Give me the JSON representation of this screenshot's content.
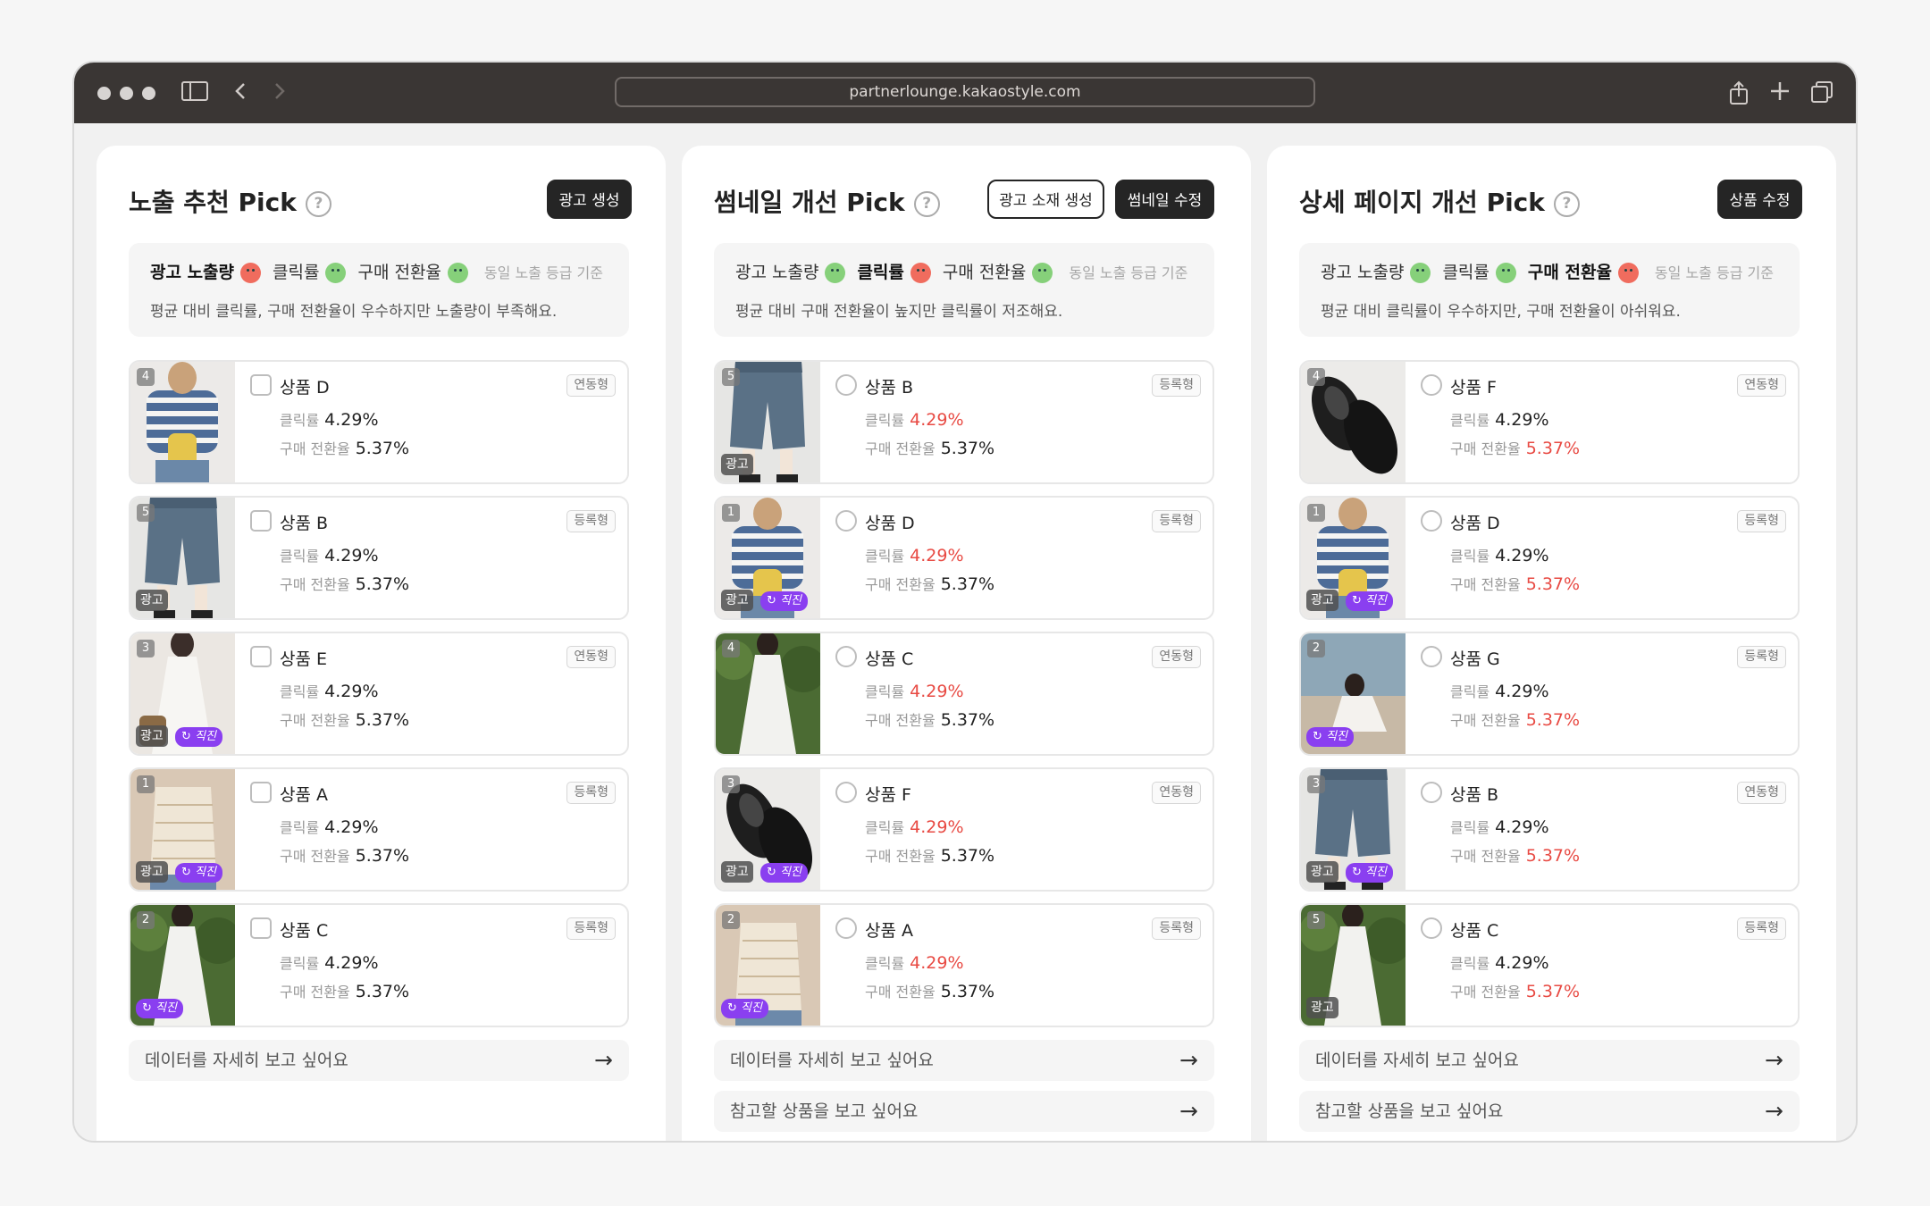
{
  "browser": {
    "url": "partnerlounge.kakaostyle.com",
    "icons": [
      "sidebar-icon",
      "back-icon",
      "forward-icon",
      "share-icon",
      "new-tab-icon",
      "tabs-icon"
    ]
  },
  "colors": {
    "accent": "#8a3ff0",
    "good": "#86d07a",
    "bad": "#f06c5e",
    "danger": "#e84a43"
  },
  "panels": [
    {
      "title": "노출 추천 Pick",
      "buttons": [
        {
          "label": "광고 생성",
          "style": "filled"
        }
      ],
      "summary": {
        "metrics": [
          {
            "label": "광고 노출량",
            "state": "bad",
            "bold": true
          },
          {
            "label": "클릭률",
            "state": "good",
            "bold": false
          },
          {
            "label": "구매 전환율",
            "state": "good",
            "bold": false
          }
        ],
        "basis": "동일 노출 등급 기준",
        "description": "평균 대비 클릭률, 구매 전환율이 우수하지만 노출량이 부족해요."
      },
      "checkbox_type": "box",
      "products": [
        {
          "rank": "4",
          "name": "상품 D",
          "type": "연동형",
          "click_label": "클릭률",
          "click": "4.29%",
          "conv_label": "구매 전환율",
          "conversion": "5.37%",
          "ad": "",
          "direct": "",
          "click_red": false,
          "conv_red": false,
          "thumb": "stripes"
        },
        {
          "rank": "5",
          "name": "상품 B",
          "type": "등록형",
          "click_label": "클릭률",
          "click": "4.29%",
          "conv_label": "구매 전환율",
          "conversion": "5.37%",
          "ad": "광고",
          "direct": "",
          "click_red": false,
          "conv_red": false,
          "thumb": "denim"
        },
        {
          "rank": "3",
          "name": "상품 E",
          "type": "연동형",
          "click_label": "클릭률",
          "click": "4.29%",
          "conv_label": "구매 전환율",
          "conversion": "5.37%",
          "ad": "광고",
          "direct": "직진",
          "click_red": false,
          "conv_red": false,
          "thumb": "whitedress"
        },
        {
          "rank": "1",
          "name": "상품 A",
          "type": "등록형",
          "click_label": "클릭률",
          "click": "4.29%",
          "conv_label": "구매 전환율",
          "conversion": "5.37%",
          "ad": "광고",
          "direct": "직진",
          "click_red": false,
          "conv_red": false,
          "thumb": "knit"
        },
        {
          "rank": "2",
          "name": "상품 C",
          "type": "등록형",
          "click_label": "클릭률",
          "click": "4.29%",
          "conv_label": "구매 전환율",
          "conversion": "5.37%",
          "ad": "",
          "direct": "직진",
          "click_red": false,
          "conv_red": false,
          "thumb": "garden"
        }
      ],
      "links": [
        "데이터를 자세히 보고 싶어요"
      ]
    },
    {
      "title": "썸네일 개선 Pick",
      "buttons": [
        {
          "label": "광고 소재 생성",
          "style": "outline"
        },
        {
          "label": "썸네일 수정",
          "style": "filled"
        }
      ],
      "summary": {
        "metrics": [
          {
            "label": "광고 노출량",
            "state": "good",
            "bold": false
          },
          {
            "label": "클릭률",
            "state": "bad",
            "bold": true
          },
          {
            "label": "구매 전환율",
            "state": "good",
            "bold": false
          }
        ],
        "basis": "동일 노출 등급 기준",
        "description": "평균 대비 구매 전환율이 높지만 클릭률이 저조해요."
      },
      "checkbox_type": "radio",
      "products": [
        {
          "rank": "5",
          "name": "상품 B",
          "type": "등록형",
          "click_label": "클릭률",
          "click": "4.29%",
          "conv_label": "구매 전환율",
          "conversion": "5.37%",
          "ad": "광고",
          "direct": "",
          "click_red": true,
          "conv_red": false,
          "thumb": "denim"
        },
        {
          "rank": "1",
          "name": "상품 D",
          "type": "등록형",
          "click_label": "클릭률",
          "click": "4.29%",
          "conv_label": "구매 전환율",
          "conversion": "5.37%",
          "ad": "광고",
          "direct": "직진",
          "click_red": true,
          "conv_red": false,
          "thumb": "stripes"
        },
        {
          "rank": "4",
          "name": "상품 C",
          "type": "연동형",
          "click_label": "클릭률",
          "click": "4.29%",
          "conv_label": "구매 전환율",
          "conversion": "5.37%",
          "ad": "",
          "direct": "",
          "click_red": true,
          "conv_red": false,
          "thumb": "garden"
        },
        {
          "rank": "3",
          "name": "상품 F",
          "type": "연동형",
          "click_label": "클릭률",
          "click": "4.29%",
          "conv_label": "구매 전환율",
          "conversion": "5.37%",
          "ad": "광고",
          "direct": "직진",
          "click_red": true,
          "conv_red": false,
          "thumb": "shoes"
        },
        {
          "rank": "2",
          "name": "상품 A",
          "type": "등록형",
          "click_label": "클릭률",
          "click": "4.29%",
          "conv_label": "구매 전환율",
          "conversion": "5.37%",
          "ad": "",
          "direct": "직진",
          "click_red": true,
          "conv_red": false,
          "thumb": "knit"
        }
      ],
      "links": [
        "데이터를 자세히 보고 싶어요",
        "참고할 상품을 보고 싶어요"
      ]
    },
    {
      "title": "상세 페이지 개선  Pick",
      "buttons": [
        {
          "label": "상품 수정",
          "style": "filled"
        }
      ],
      "summary": {
        "metrics": [
          {
            "label": "광고 노출량",
            "state": "good",
            "bold": false
          },
          {
            "label": "클릭률",
            "state": "good",
            "bold": false
          },
          {
            "label": "구매 전환율",
            "state": "bad",
            "bold": true
          }
        ],
        "basis": "동일 노출 등급 기준",
        "description": "평균 대비 클릭률이 우수하지만, 구매 전환율이 아쉬워요."
      },
      "checkbox_type": "radio",
      "products": [
        {
          "rank": "4",
          "name": "상품 F",
          "type": "연동형",
          "click_label": "클릭률",
          "click": "4.29%",
          "conv_label": "구매 전환율",
          "conversion": "5.37%",
          "ad": "",
          "direct": "",
          "click_red": false,
          "conv_red": true,
          "thumb": "shoes"
        },
        {
          "rank": "1",
          "name": "상품 D",
          "type": "등록형",
          "click_label": "클릭률",
          "click": "4.29%",
          "conv_label": "구매 전환율",
          "conversion": "5.37%",
          "ad": "광고",
          "direct": "직진",
          "click_red": false,
          "conv_red": true,
          "thumb": "stripes"
        },
        {
          "rank": "2",
          "name": "상품 G",
          "type": "등록형",
          "click_label": "클릭률",
          "click": "4.29%",
          "conv_label": "구매 전환율",
          "conversion": "5.37%",
          "ad": "",
          "direct": "직진",
          "click_red": false,
          "conv_red": true,
          "thumb": "beach"
        },
        {
          "rank": "3",
          "name": "상품 B",
          "type": "연동형",
          "click_label": "클릭률",
          "click": "4.29%",
          "conv_label": "구매 전환율",
          "conversion": "5.37%",
          "ad": "광고",
          "direct": "직진",
          "click_red": false,
          "conv_red": true,
          "thumb": "denim"
        },
        {
          "rank": "5",
          "name": "상품 C",
          "type": "등록형",
          "click_label": "클릭률",
          "click": "4.29%",
          "conv_label": "구매 전환율",
          "conversion": "5.37%",
          "ad": "광고",
          "direct": "",
          "click_red": false,
          "conv_red": true,
          "thumb": "garden"
        }
      ],
      "links": [
        "데이터를 자세히 보고 싶어요",
        "참고할 상품을 보고 싶어요"
      ]
    }
  ]
}
